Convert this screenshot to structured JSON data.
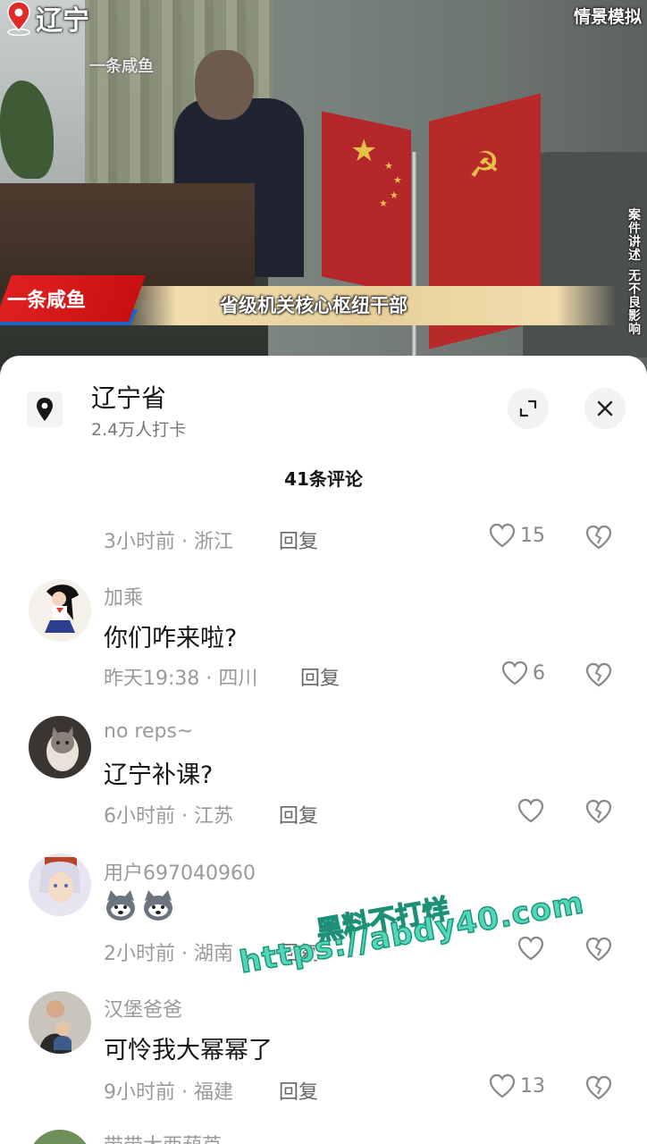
{
  "video": {
    "location_label": "辽宁",
    "channel_watermark": "一条咸鱼",
    "scene_tag": "情景模拟",
    "side_note_top": "案件讲述",
    "side_note_bottom": "无不良影响",
    "channel_banner": "一条咸鱼",
    "caption": "省级机关核心枢纽干部"
  },
  "location_panel": {
    "name": "辽宁省",
    "checkins": "2.4万人打卡",
    "icons": {
      "location": "location-pin-icon",
      "expand": "expand-icon",
      "close": "close-icon"
    }
  },
  "comments_title": "41条评论",
  "comments": [
    {
      "user": "",
      "text": "",
      "time": "3小时前",
      "region": "浙江",
      "reply": "回复",
      "likes": "15"
    },
    {
      "user": "加乘",
      "text": "你们咋来啦?",
      "time": "昨天19:38",
      "region": "四川",
      "reply": "回复",
      "likes": "6"
    },
    {
      "user": "no reps~",
      "text": "辽宁补课?",
      "time": "6小时前",
      "region": "江苏",
      "reply": "回复",
      "likes": ""
    },
    {
      "user": "用户697040960",
      "text": "",
      "emoji": "husky-face-emoji",
      "time": "2小时前",
      "region": "湖南",
      "reply": "回复",
      "likes": ""
    },
    {
      "user": "汉堡爸爸",
      "text": "可怜我大幂幂了",
      "time": "9小时前",
      "region": "福建",
      "reply": "回复",
      "likes": "13"
    },
    {
      "user": "带带大西葫芦",
      "text": "",
      "time": "",
      "region": "",
      "reply": "",
      "likes": ""
    }
  ],
  "meta_separator": " · ",
  "overlay_watermark": {
    "line1": "黑料不打烊",
    "line2": "https://abdy40.com"
  },
  "colors": {
    "accent_red": "#e02020",
    "banner_blue": "#1f63c9",
    "gold": "#e8cf98",
    "text_muted": "#9a9a9a",
    "watermark": "#52d8b8"
  }
}
